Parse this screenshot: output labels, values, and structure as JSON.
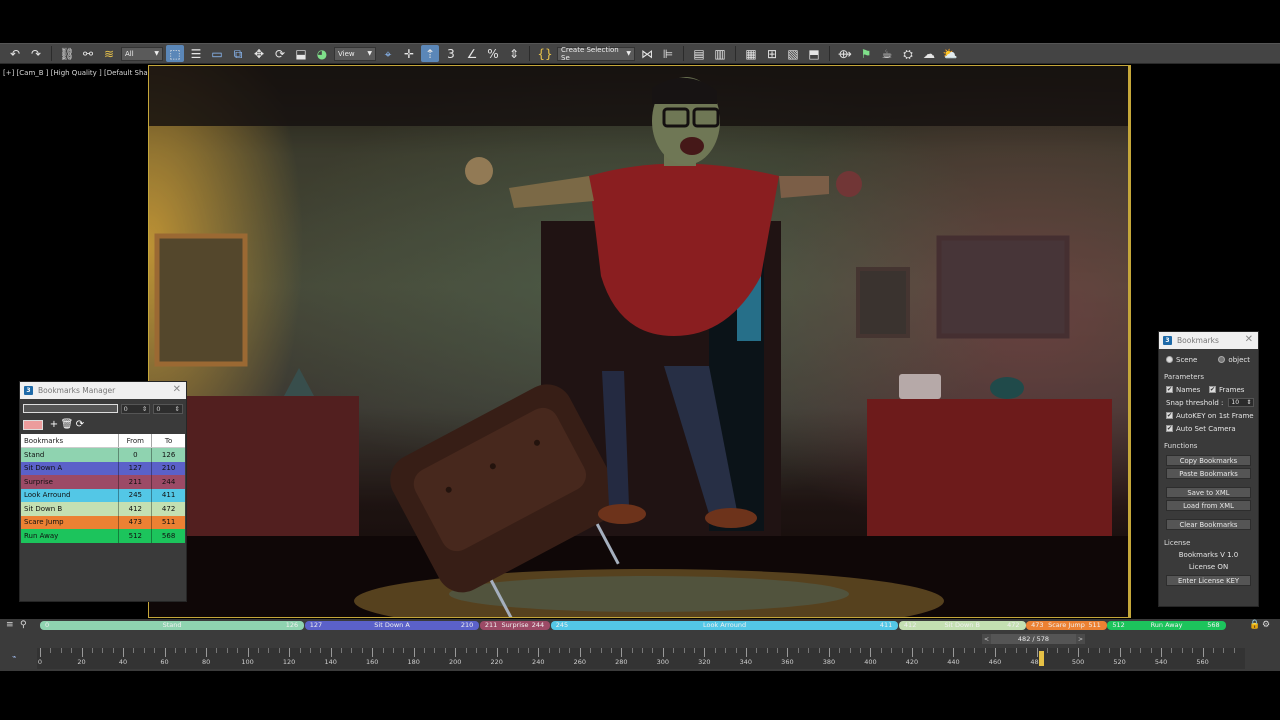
{
  "toolbar": {
    "filter_dropdown": "All",
    "reference_dropdown": "View",
    "selection_set_dropdown": "Create Selection Se"
  },
  "viewport": {
    "label": "[+] [Cam_B ] [High Quality ] [Default Shading ]"
  },
  "bookmarks_manager": {
    "title": "Bookmarks Manager",
    "from_value": "0",
    "to_value": "0",
    "swatch_color": "#ec9c9c",
    "columns": {
      "name": "Bookmarks",
      "from": "From",
      "to": "To"
    },
    "rows": [
      {
        "name": "Stand",
        "from": "0",
        "to": "126",
        "color": "#8fd3b0"
      },
      {
        "name": "Sit Down A",
        "from": "127",
        "to": "210",
        "color": "#5b61c9"
      },
      {
        "name": "Surprise",
        "from": "211",
        "to": "244",
        "color": "#9c4a66"
      },
      {
        "name": "Look Arround",
        "from": "245",
        "to": "411",
        "color": "#53c7e6"
      },
      {
        "name": "Sit Down B",
        "from": "412",
        "to": "472",
        "color": "#c4e0b2"
      },
      {
        "name": "Scare Jump",
        "from": "473",
        "to": "511",
        "color": "#ec8133"
      },
      {
        "name": "Run Away",
        "from": "512",
        "to": "568",
        "color": "#1cc45c"
      }
    ]
  },
  "bookmarks_panel": {
    "title": "Bookmarks",
    "radio_scene": "Scene",
    "radio_object": "object",
    "parameters_label": "Parameters",
    "names_label": "Names",
    "frames_label": "Frames",
    "snap_label": "Snap threshold :",
    "snap_value": "10",
    "autokey_label": "AutoKEY on 1st Frame",
    "autocam_label": "Auto Set Camera",
    "functions_label": "Functions",
    "copy_btn": "Copy Bookmarks",
    "paste_btn": "Paste Bookmarks",
    "save_btn": "Save to XML",
    "load_btn": "Load from XML",
    "clear_btn": "Clear Bookmarks",
    "license_label": "License",
    "version_text": "Bookmarks V 1.0",
    "license_status": "License ON",
    "license_btn": "Enter License KEY"
  },
  "timeline": {
    "frame_counter": "482 / 578",
    "current_frame": 482,
    "max_frame": 578,
    "ruler_labels": [
      "0",
      "20",
      "40",
      "60",
      "80",
      "100",
      "120",
      "140",
      "160",
      "180",
      "200",
      "220",
      "240",
      "260",
      "280",
      "300",
      "320",
      "340",
      "360",
      "380",
      "400",
      "420",
      "440",
      "460",
      "480",
      "500",
      "520",
      "540",
      "560"
    ]
  }
}
